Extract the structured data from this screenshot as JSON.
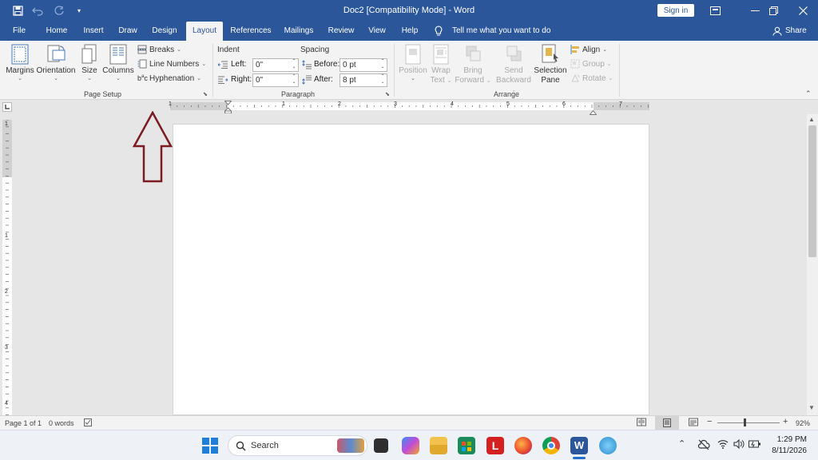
{
  "titlebar": {
    "title": "Doc2 [Compatibility Mode] - Word",
    "sign_in": "Sign in",
    "icons": [
      "save-icon",
      "undo-icon",
      "redo-icon",
      "customize-qat-icon",
      "ribbon-display-icon",
      "minimize-icon",
      "restore-icon",
      "close-icon"
    ]
  },
  "tabs": [
    "File",
    "Home",
    "Insert",
    "Draw",
    "Design",
    "Layout",
    "References",
    "Mailings",
    "Review",
    "View",
    "Help"
  ],
  "active_tab": "Layout",
  "tell_me": "Tell me what you want to do",
  "share": "Share",
  "page_setup": {
    "label": "Page Setup",
    "margins": "Margins",
    "orientation": "Orientation",
    "size": "Size",
    "columns": "Columns",
    "breaks": "Breaks",
    "line_numbers": "Line Numbers",
    "hyphenation": "Hyphenation"
  },
  "paragraph": {
    "label": "Paragraph",
    "indent": "Indent",
    "spacing": "Spacing",
    "left_label": "Left:",
    "left_value": "0\"",
    "right_label": "Right:",
    "right_value": "0\"",
    "before_label": "Before:",
    "before_value": "0 pt",
    "after_label": "After:",
    "after_value": "8 pt"
  },
  "arrange": {
    "label": "Arrange",
    "position": "Position",
    "wrap_text_1": "Wrap",
    "wrap_text_2": "Text",
    "bring_forward_1": "Bring",
    "bring_forward_2": "Forward",
    "send_backward_1": "Send",
    "send_backward_2": "Backward",
    "selection_pane_1": "Selection",
    "selection_pane_2": "Pane",
    "align": "Align",
    "group": "Group",
    "rotate": "Rotate"
  },
  "ruler": {
    "h_numbers": [
      "1",
      "1",
      "2",
      "3",
      "4",
      "5",
      "6",
      "7"
    ],
    "v_numbers": [
      "1",
      "1",
      "2",
      "3",
      "4"
    ]
  },
  "status": {
    "page": "Page 1 of 1",
    "words": "0 words",
    "zoom": "92%"
  },
  "taskbar": {
    "search": "Search",
    "time": "1:29 PM",
    "date": "8/11/2026"
  },
  "colors": {
    "accent": "#2b579a",
    "arrow": "#7b1c22"
  }
}
